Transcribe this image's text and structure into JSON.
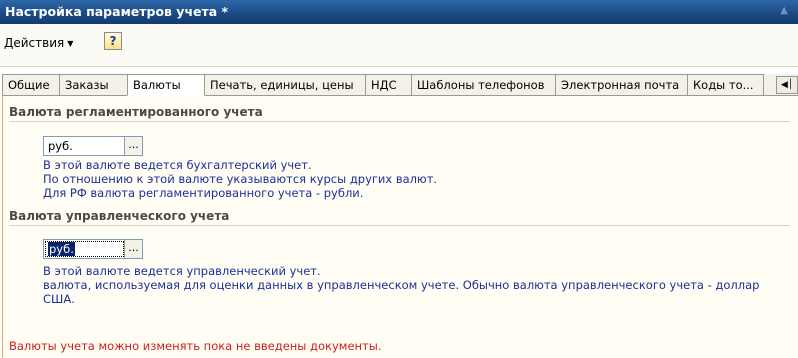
{
  "window": {
    "title": "Настройка параметров учета *"
  },
  "toolbar": {
    "actions_label": "Действия",
    "help_label": "?"
  },
  "tabs": [
    {
      "label": "Общие"
    },
    {
      "label": "Заказы"
    },
    {
      "label": "Валюты"
    },
    {
      "label": "Печать, единицы, цены"
    },
    {
      "label": "НДС"
    },
    {
      "label": "Шаблоны телефонов"
    },
    {
      "label": "Электронная почта"
    },
    {
      "label": "Коды то..."
    }
  ],
  "active_tab": "Валюты",
  "regulated": {
    "heading": "Валюта регламентированного учета",
    "value": "руб.",
    "button": "...",
    "notes": [
      "В этой валюте ведется бухгалтерский учет.",
      "По отношению к этой валюте указываются курсы других валют.",
      "Для РФ валюта регламентированного учета - рубли."
    ]
  },
  "management": {
    "heading": "Валюта управленческого учета",
    "value": "руб.",
    "button": "...",
    "notes": [
      "В этой валюте ведется управленческий учет.",
      "валюта, используемая для оценки данных в управленческом учете. Обычно валюта управленческого учета - доллар",
      "США."
    ]
  },
  "warning": "Валюты учета можно изменять пока не введены документы.",
  "colors": {
    "title_bar": "#1b4b86",
    "note_text": "#1e2f9a",
    "warning_text": "#cc1f1f",
    "selection": "#0a246a"
  }
}
